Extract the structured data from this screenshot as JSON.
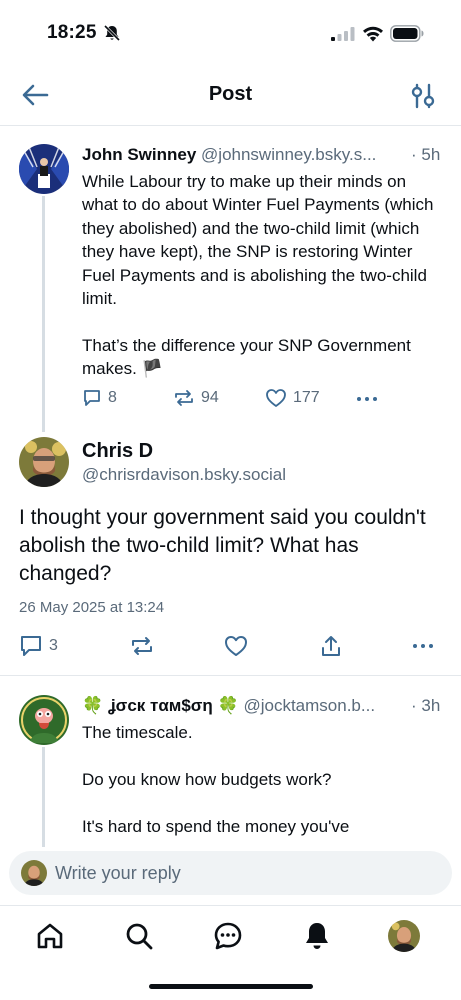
{
  "status_bar": {
    "time": "18:25"
  },
  "header": {
    "title": "Post"
  },
  "parent_post": {
    "author_name": "John Swinney",
    "author_handle": "@johnswinney.bsky.s...",
    "time": "· 5h",
    "text": "While Labour try to make up their minds on what to do about Winter Fuel Payments (which they abolished) and the two-child limit (which they have kept), the SNP is restoring Winter Fuel Payments and is abolishing the two-child limit.\n\nThat’s the difference your SNP Government makes. 🏴",
    "replies": "8",
    "reposts": "94",
    "likes": "177"
  },
  "focused_post": {
    "author_name": "Chris D",
    "author_handle": "@chrisrdavison.bsky.social",
    "text": "I thought your government said you couldn't abolish the two-child limit? What has changed?",
    "date": "26 May 2025 at 13:24",
    "replies": "3"
  },
  "reply_post": {
    "author_name": "🍀 ʝσcк тαм$ση 🍀",
    "author_handle": "@jocktamson.b...",
    "time": "· 3h",
    "text": "The timescale.\n\nDo you know how budgets work?\n\nIt's hard to spend the money you've"
  },
  "composer": {
    "placeholder": "Write your reply"
  },
  "colors": {
    "accent": "#1083fe",
    "icon_gray": "#5a6a7a",
    "header_icon": "#3b6a94"
  }
}
